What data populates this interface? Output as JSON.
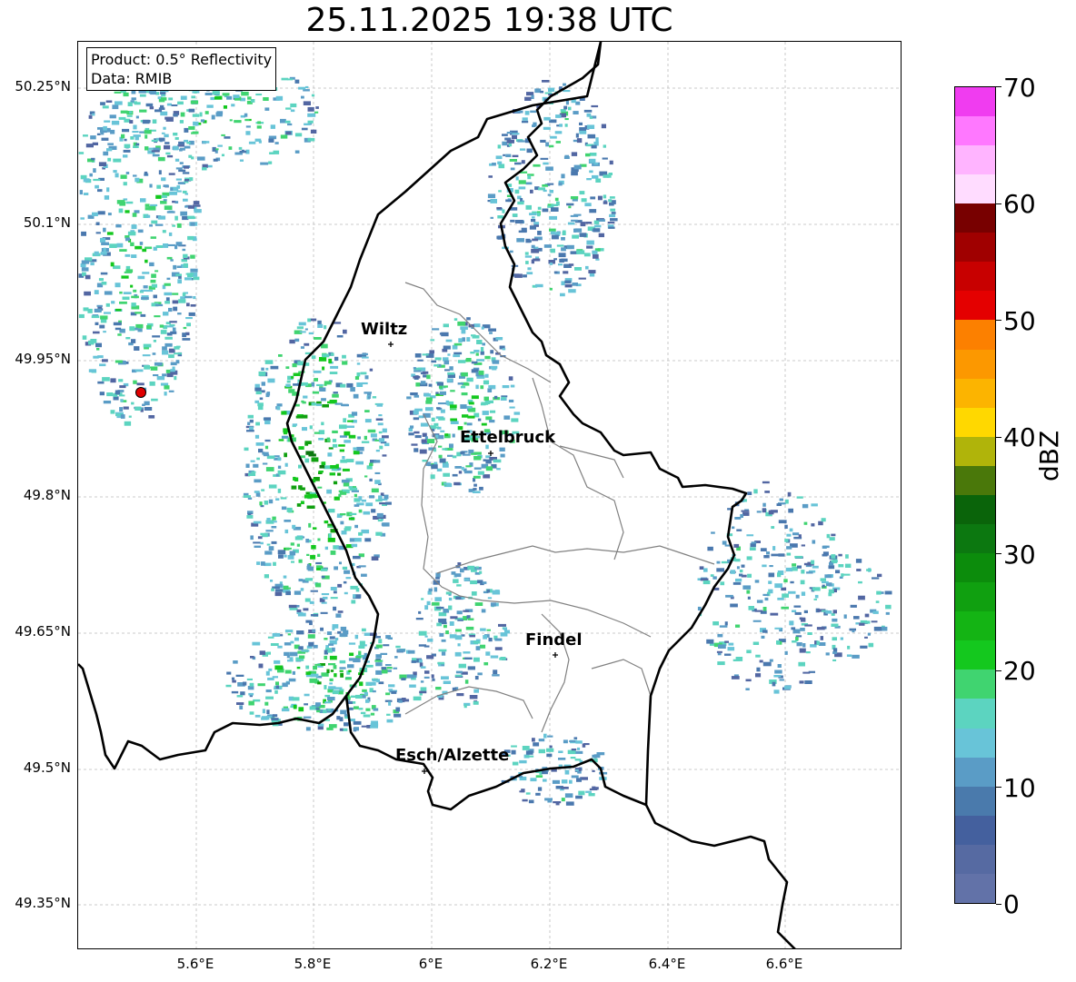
{
  "title": "25.11.2025 19:38 UTC",
  "info": {
    "product": "Product: 0.5° Reflectivity",
    "data": "Data: RMIB"
  },
  "axes": {
    "lat_labels": [
      "50.25°N",
      "50.1°N",
      "49.95°N",
      "49.8°N",
      "49.65°N",
      "49.5°N",
      "49.35°N"
    ],
    "lon_labels": [
      "5.6°E",
      "5.8°E",
      "6°E",
      "6.2°E",
      "6.4°E",
      "6.6°E"
    ]
  },
  "cities": [
    {
      "name": "Wiltz"
    },
    {
      "name": "Ettelbruck"
    },
    {
      "name": "Findel"
    },
    {
      "name": "Esch/Alzette"
    }
  ],
  "colorbar": {
    "label": "dBZ",
    "ticks": [
      "0",
      "10",
      "20",
      "30",
      "40",
      "50",
      "60",
      "70"
    ],
    "colors": [
      "#6272a8",
      "#566aa2",
      "#44609e",
      "#4a7aac",
      "#5a9cc6",
      "#68c4d8",
      "#5cd4c0",
      "#40d470",
      "#14c81e",
      "#14b414",
      "#10a010",
      "#0c8c0c",
      "#0c7810",
      "#0a640a",
      "#4a780a",
      "#b0b40a",
      "#ffd800",
      "#fcb400",
      "#fc9800",
      "#fc8000",
      "#e40000",
      "#c80000",
      "#a00000",
      "#780000",
      "#ffdcff",
      "#ffb4ff",
      "#ff78ff",
      "#f03cf0"
    ]
  },
  "colors": {
    "border": "#000000",
    "canton": "#808080",
    "grid": "#bbbbbb",
    "radar_site": "#e00000"
  }
}
